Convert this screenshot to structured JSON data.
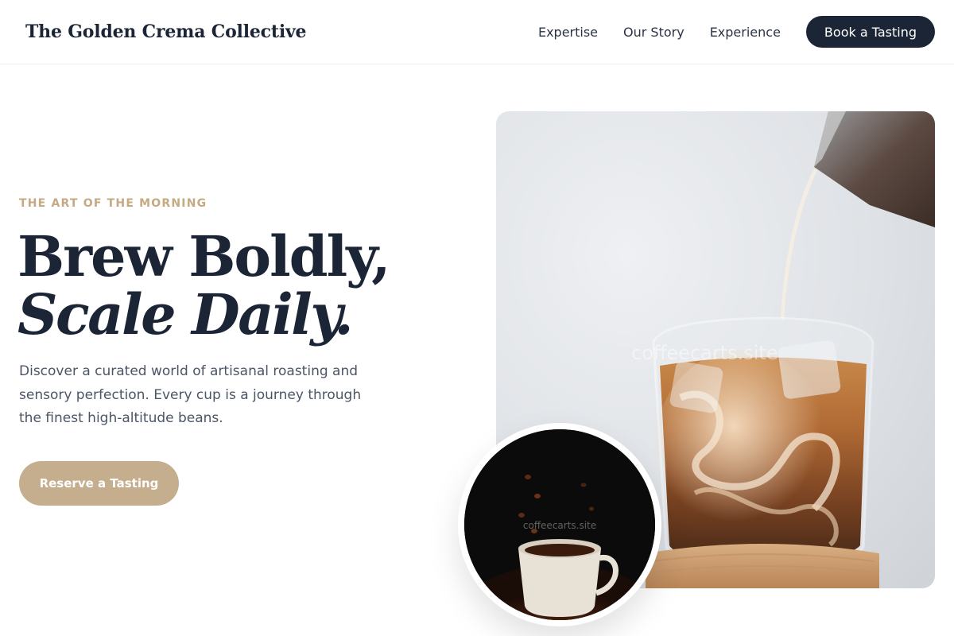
{
  "header": {
    "logo": "The Golden Crema Collective",
    "nav": [
      "Expertise",
      "Our Story",
      "Experience"
    ],
    "cta": "Book a Tasting"
  },
  "hero": {
    "eyebrow": "THE ART OF THE MORNING",
    "headline_line1": "Brew Boldly,",
    "headline_line2": "Scale Daily.",
    "lead": "Discover a curated world of artisanal roasting and sensory perfection. Every cup is a journey through the finest high-altitude beans.",
    "cta": "Reserve a Tasting"
  },
  "images": {
    "main_watermark": "coffeecarts.site",
    "circle_watermark": "coffeecarts.site"
  },
  "colors": {
    "navy": "#1c2536",
    "gold": "#c4a983",
    "button_tan": "#c4ae8e",
    "body_text": "#4b5566"
  }
}
